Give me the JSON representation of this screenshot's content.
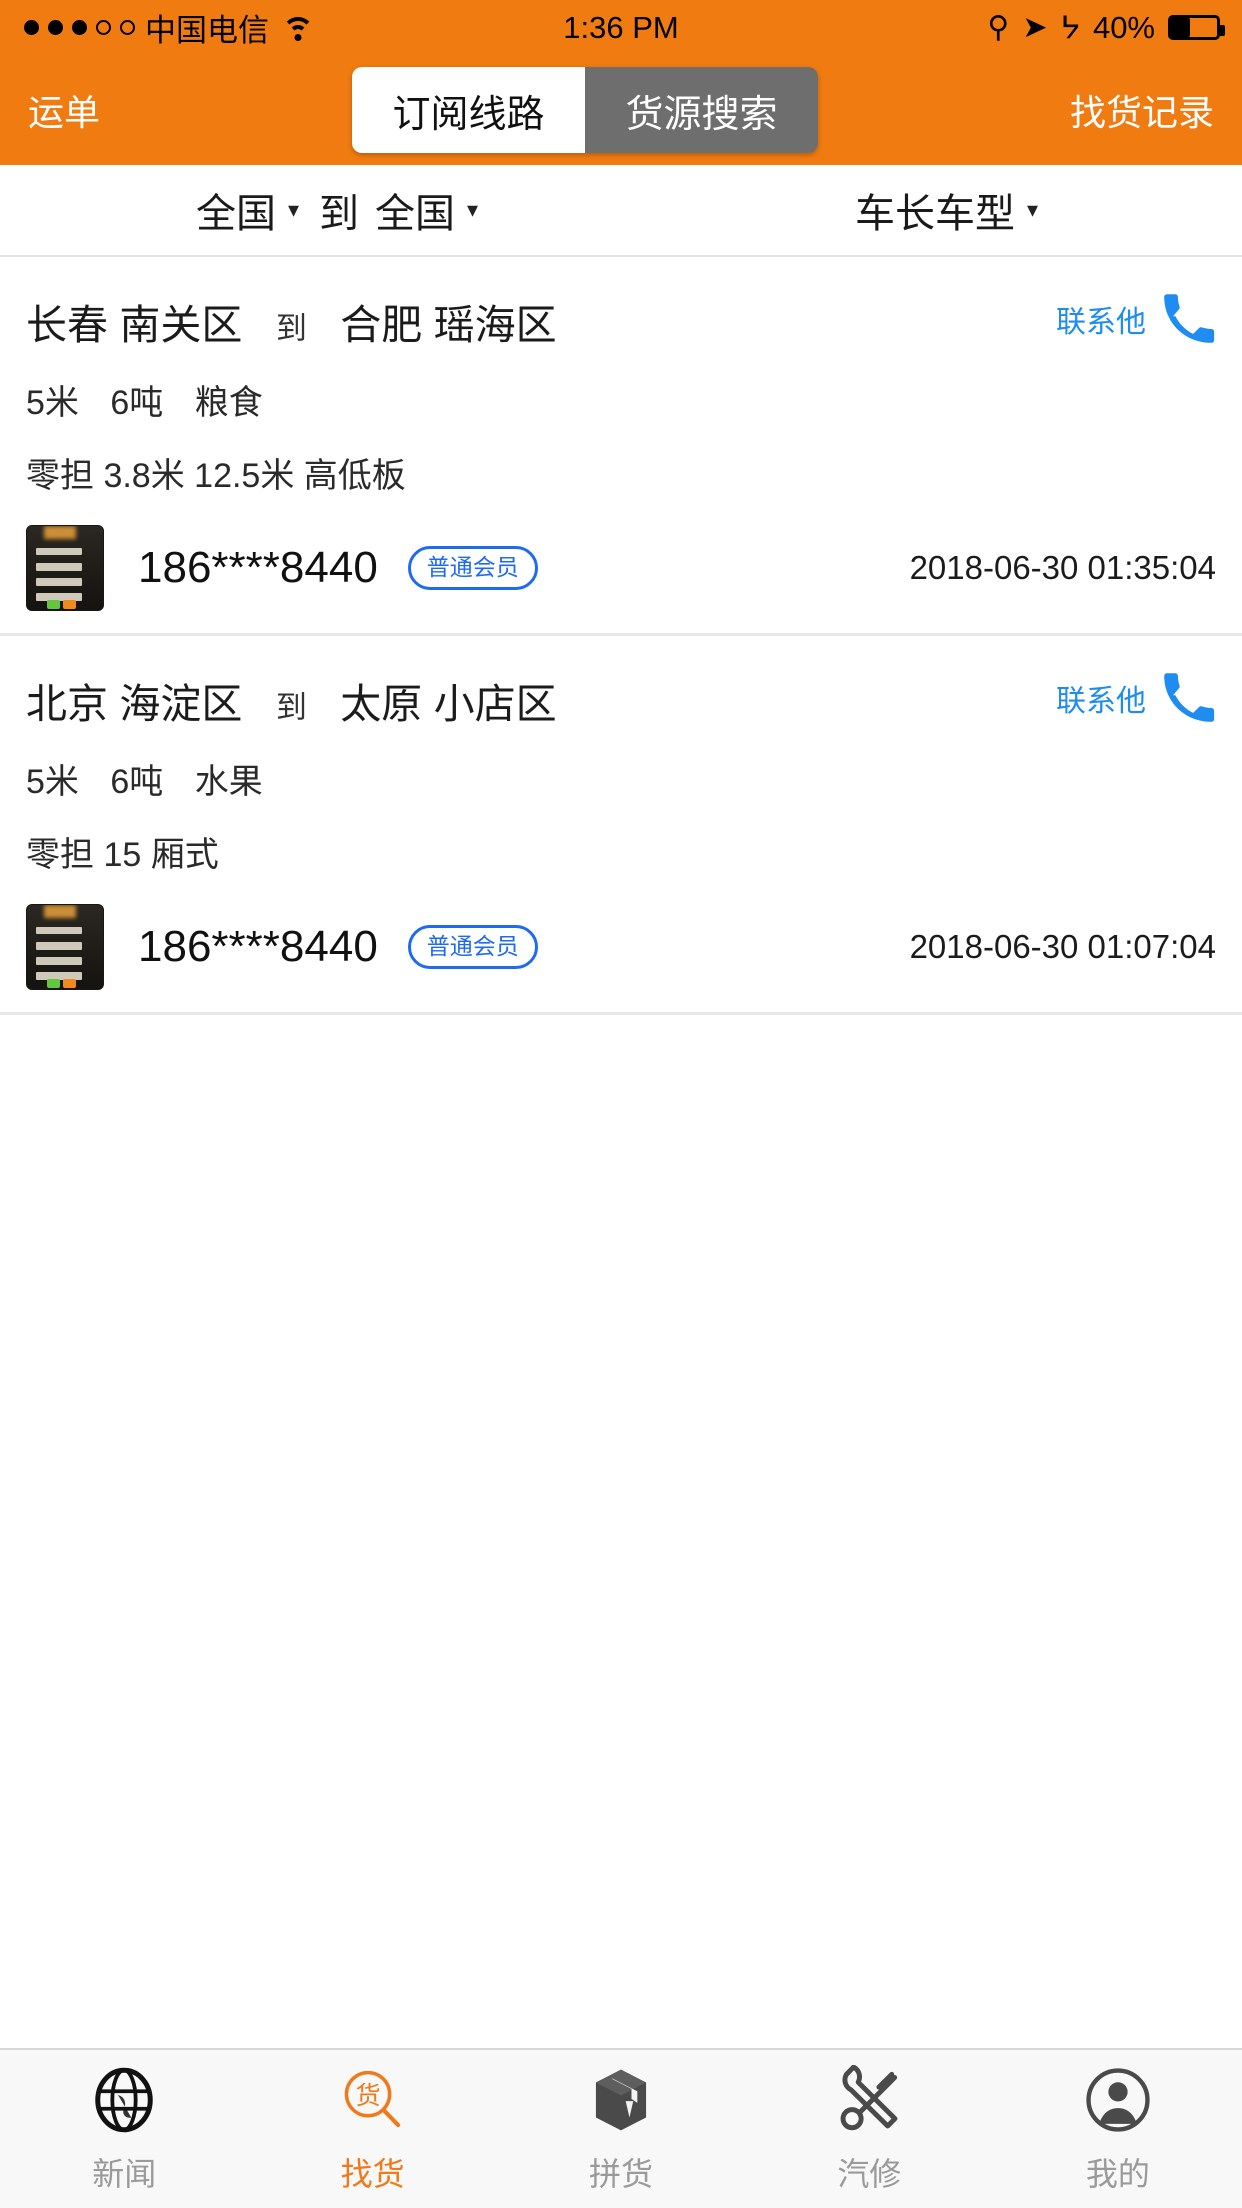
{
  "statusbar": {
    "carrier": "中国电信",
    "time": "1:36 PM",
    "battery_percent": "40%",
    "signal_dots_filled": 3,
    "signal_dots_total": 5,
    "icons": [
      "wifi-icon",
      "rotation-lock-icon",
      "location-arrow-icon",
      "bluetooth-icon",
      "battery-icon"
    ]
  },
  "navbar": {
    "left_button": "运单",
    "right_button": "找货记录",
    "segments": [
      {
        "label": "订阅线路",
        "active": true
      },
      {
        "label": "货源搜索",
        "active": false
      }
    ]
  },
  "filterbar": {
    "origin": "全国",
    "connector": "到",
    "destination": "全国",
    "truck_filter": "车长车型",
    "caret": "▾"
  },
  "cards": [
    {
      "origin_city": "长春",
      "origin_district": "南关区",
      "connector": "到",
      "dest_city": "合肥",
      "dest_district": "瑶海区",
      "contact_label": "联系他",
      "spec_length": "5米",
      "spec_weight": "6吨",
      "spec_cargo": "粮食",
      "truck_types": "零担 3.8米 12.5米 高低板",
      "phone": "186****8440",
      "member_badge": "普通会员",
      "timestamp": "2018-06-30 01:35:04"
    },
    {
      "origin_city": "北京",
      "origin_district": "海淀区",
      "connector": "到",
      "dest_city": "太原",
      "dest_district": "小店区",
      "contact_label": "联系他",
      "spec_length": "5米",
      "spec_weight": "6吨",
      "spec_cargo": "水果",
      "truck_types": "零担 15 厢式",
      "phone": "186****8440",
      "member_badge": "普通会员",
      "timestamp": "2018-06-30 01:07:04"
    }
  ],
  "tabbar": {
    "items": [
      {
        "label": "新闻",
        "icon": "globe-icon",
        "active": false
      },
      {
        "label": "找货",
        "icon": "cargo-search-icon",
        "active": true
      },
      {
        "label": "拼货",
        "icon": "box-icon",
        "active": false
      },
      {
        "label": "汽修",
        "icon": "repair-tools-icon",
        "active": false
      },
      {
        "label": "我的",
        "icon": "user-profile-icon",
        "active": false
      }
    ]
  },
  "colors": {
    "brand_orange": "#F07B10",
    "accent_blue": "#1E8CF0",
    "badge_blue": "#1E6BF0",
    "tab_active": "#F0791A",
    "tab_inactive": "#9A9A9A"
  }
}
